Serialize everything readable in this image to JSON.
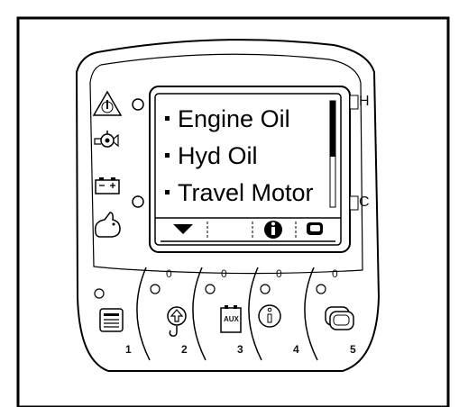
{
  "display": {
    "menu_items": [
      "Engine Oil",
      "Hyd Oil",
      "Travel Motor"
    ]
  },
  "side_labels": {
    "top": "H",
    "bottom": "C"
  },
  "aux_label": "AUX",
  "buttons": [
    {
      "number": "1",
      "icon": "menu-icon"
    },
    {
      "number": "2",
      "icon": "hook-lift-icon"
    },
    {
      "number": "3",
      "icon": "aux-icon"
    },
    {
      "number": "4",
      "icon": "info-icon"
    },
    {
      "number": "5",
      "icon": "screen-toggle-icon"
    }
  ],
  "button_leds": [
    "0",
    "0",
    "0",
    "0"
  ],
  "softkey_icons": [
    "down-arrow-icon",
    "info-icon",
    "screen-toggle-icon"
  ],
  "warning_icons": [
    "warning-icon",
    "oil-pressure-icon",
    "battery-icon",
    "rabbit-speed-icon"
  ]
}
